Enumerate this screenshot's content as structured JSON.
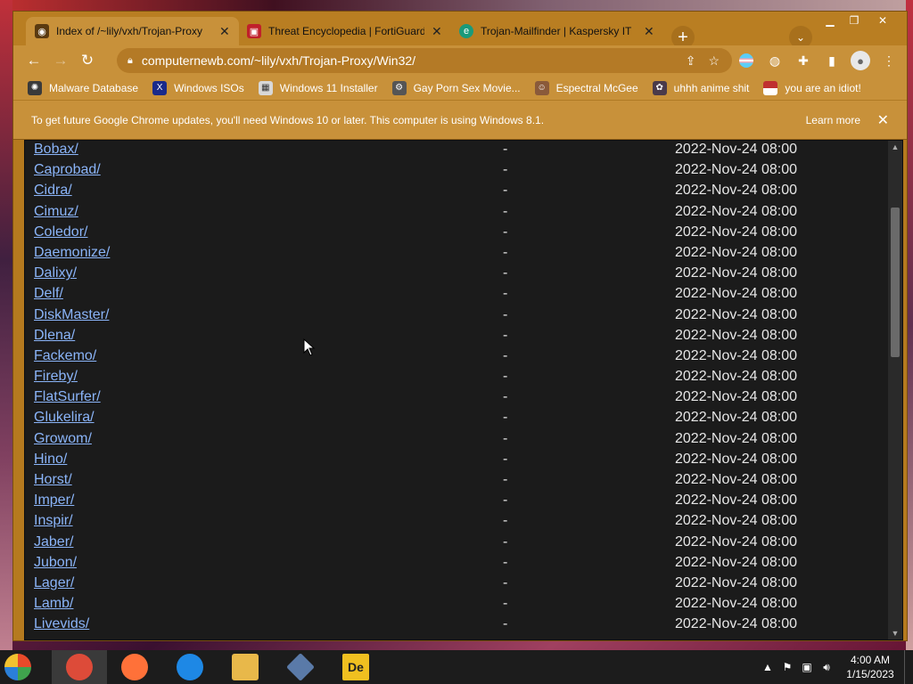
{
  "tabs": [
    {
      "title": "Index of /~lily/vxh/Trojan-Proxy",
      "icon": "globe-icon",
      "active": true
    },
    {
      "title": "Threat Encyclopedia | FortiGuard",
      "icon": "fortiguard-shield-icon",
      "active": false
    },
    {
      "title": "Trojan-Mailfinder | Kaspersky IT",
      "icon": "kaspersky-e-icon",
      "active": false
    }
  ],
  "address_bar": {
    "url": "computernewb.com/~lily/vxh/Trojan-Proxy/Win32/"
  },
  "bookmarks": [
    {
      "label": "Malware Database",
      "icon": "virus-icon"
    },
    {
      "label": "Windows ISOs",
      "icon": "x-icon"
    },
    {
      "label": "Windows 11 Installer",
      "icon": "installer-icon"
    },
    {
      "label": "Gay Porn Sex Movie...",
      "icon": "gear-site-icon"
    },
    {
      "label": "Espectral McGee",
      "icon": "face-icon"
    },
    {
      "label": "uhhh anime shit",
      "icon": "anime-icon"
    },
    {
      "label": "you are an idiot!",
      "icon": "flag-icon"
    }
  ],
  "infobar": {
    "message": "To get future Google Chrome updates, you'll need Windows 10 or later. This computer is using Windows 8.1.",
    "learn_more": "Learn more"
  },
  "listing": [
    {
      "name": "Bobax/",
      "size": "-",
      "date": "2022-Nov-24 08:00"
    },
    {
      "name": "Caprobad/",
      "size": "-",
      "date": "2022-Nov-24 08:00"
    },
    {
      "name": "Cidra/",
      "size": "-",
      "date": "2022-Nov-24 08:00"
    },
    {
      "name": "Cimuz/",
      "size": "-",
      "date": "2022-Nov-24 08:00"
    },
    {
      "name": "Coledor/",
      "size": "-",
      "date": "2022-Nov-24 08:00"
    },
    {
      "name": "Daemonize/",
      "size": "-",
      "date": "2022-Nov-24 08:00"
    },
    {
      "name": "Dalixy/",
      "size": "-",
      "date": "2022-Nov-24 08:00"
    },
    {
      "name": "Delf/",
      "size": "-",
      "date": "2022-Nov-24 08:00"
    },
    {
      "name": "DiskMaster/",
      "size": "-",
      "date": "2022-Nov-24 08:00"
    },
    {
      "name": "Dlena/",
      "size": "-",
      "date": "2022-Nov-24 08:00"
    },
    {
      "name": "Fackemo/",
      "size": "-",
      "date": "2022-Nov-24 08:00"
    },
    {
      "name": "Fireby/",
      "size": "-",
      "date": "2022-Nov-24 08:00"
    },
    {
      "name": "FlatSurfer/",
      "size": "-",
      "date": "2022-Nov-24 08:00"
    },
    {
      "name": "Glukelira/",
      "size": "-",
      "date": "2022-Nov-24 08:00"
    },
    {
      "name": "Growom/",
      "size": "-",
      "date": "2022-Nov-24 08:00"
    },
    {
      "name": "Hino/",
      "size": "-",
      "date": "2022-Nov-24 08:00"
    },
    {
      "name": "Horst/",
      "size": "-",
      "date": "2022-Nov-24 08:00"
    },
    {
      "name": "Imper/",
      "size": "-",
      "date": "2022-Nov-24 08:00"
    },
    {
      "name": "Inspir/",
      "size": "-",
      "date": "2022-Nov-24 08:00"
    },
    {
      "name": "Jaber/",
      "size": "-",
      "date": "2022-Nov-24 08:00"
    },
    {
      "name": "Jubon/",
      "size": "-",
      "date": "2022-Nov-24 08:00"
    },
    {
      "name": "Lager/",
      "size": "-",
      "date": "2022-Nov-24 08:00"
    },
    {
      "name": "Lamb/",
      "size": "-",
      "date": "2022-Nov-24 08:00"
    },
    {
      "name": "Livevids/",
      "size": "-",
      "date": "2022-Nov-24 08:00"
    }
  ],
  "taskbar": {
    "apps": [
      {
        "name": "chrome",
        "icon": "chrome-icon",
        "color": "#dd4b39"
      },
      {
        "name": "firefox",
        "icon": "firefox-icon",
        "color": "#ff7139"
      },
      {
        "name": "opera",
        "icon": "opera-icon",
        "color": "#1e88e5"
      },
      {
        "name": "file-explorer",
        "icon": "folder-icon",
        "color": "#e8b84a"
      },
      {
        "name": "app",
        "icon": "diamond-app-icon",
        "color": "#5a7aa8"
      },
      {
        "name": "decompiler",
        "icon": "de-icon",
        "color": "#f0c020",
        "label": "De"
      }
    ],
    "time": "4:00 AM",
    "date": "1/15/2023"
  },
  "colors": {
    "chrome_theme": "#c8913a",
    "link": "#8ab4f8",
    "page_bg": "#1b1b1b"
  }
}
